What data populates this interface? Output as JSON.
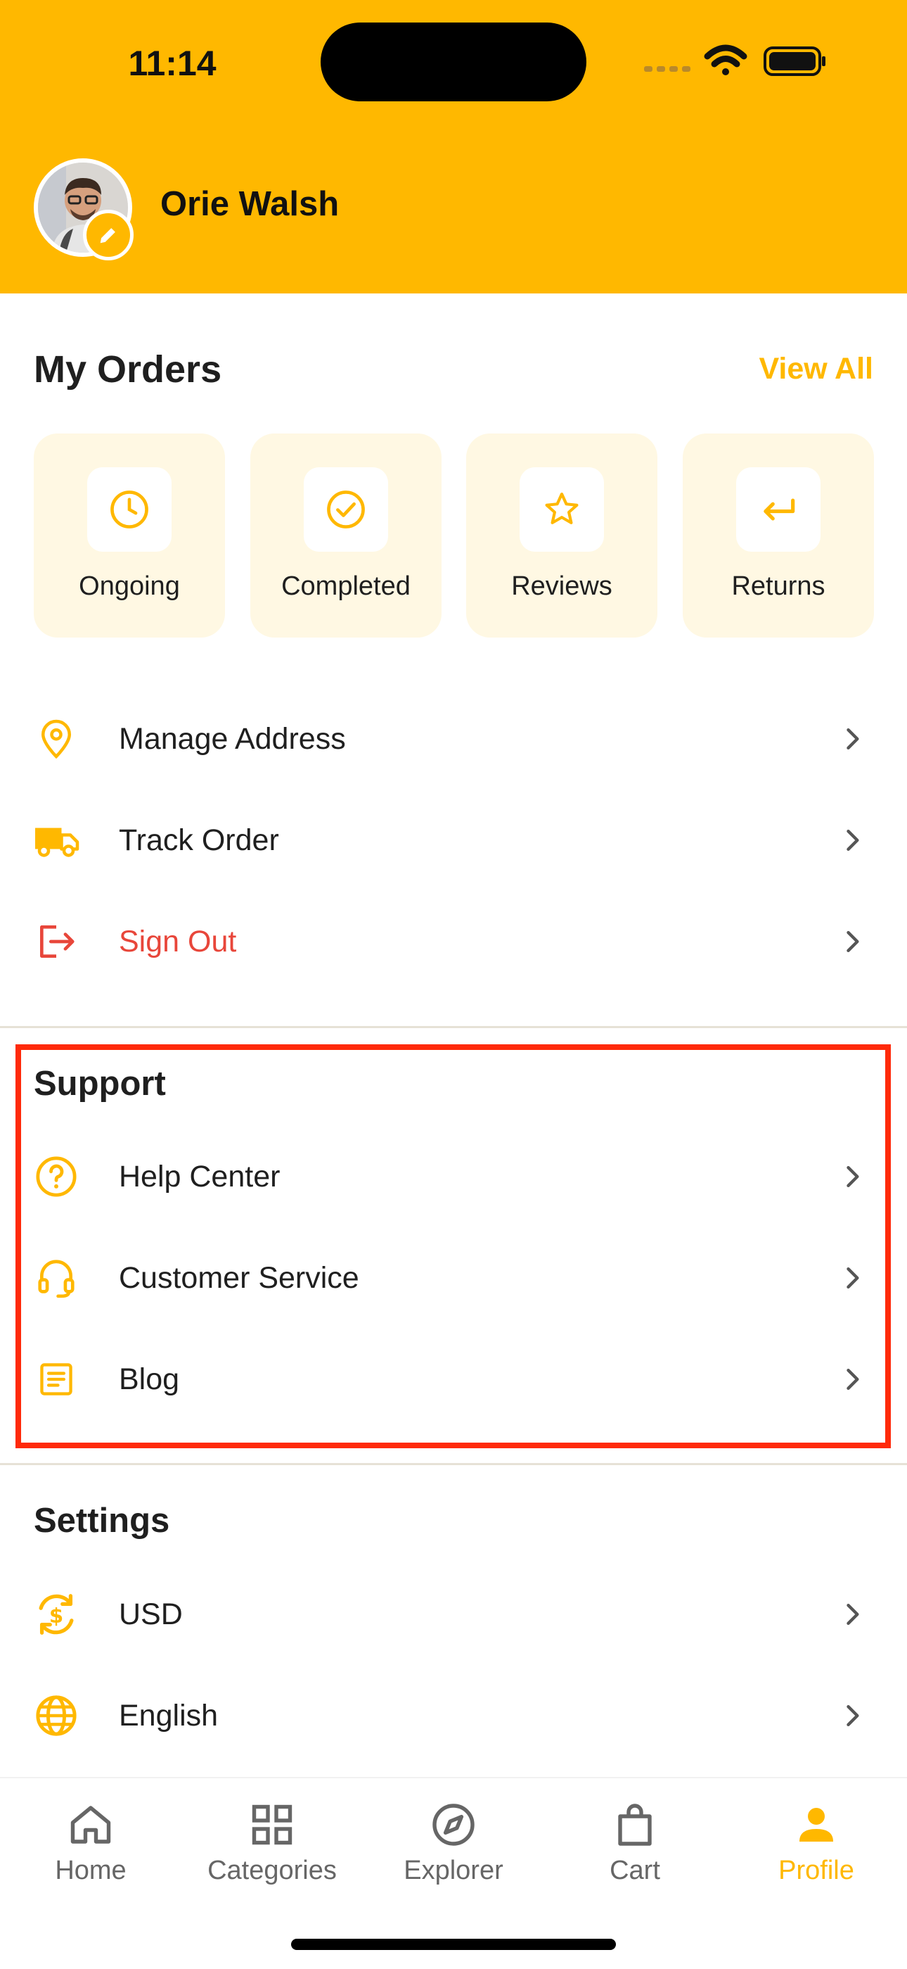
{
  "status_bar": {
    "time": "11:14"
  },
  "profile": {
    "name": "Orie Walsh"
  },
  "orders": {
    "title": "My Orders",
    "view_all": "View All",
    "items": [
      {
        "label": "Ongoing",
        "icon": "clock-icon"
      },
      {
        "label": "Completed",
        "icon": "check-circle-icon"
      },
      {
        "label": "Reviews",
        "icon": "star-icon"
      },
      {
        "label": "Returns",
        "icon": "return-arrow-icon"
      }
    ]
  },
  "account_menu": [
    {
      "label": "Manage Address",
      "icon": "location-pin-icon"
    },
    {
      "label": "Track Order",
      "icon": "truck-icon"
    },
    {
      "label": "Sign Out",
      "icon": "sign-out-icon",
      "color": "#E8463A"
    }
  ],
  "support": {
    "title": "Support",
    "items": [
      {
        "label": "Help Center",
        "icon": "help-circle-icon"
      },
      {
        "label": "Customer Service",
        "icon": "headset-icon"
      },
      {
        "label": "Blog",
        "icon": "document-icon"
      }
    ]
  },
  "settings": {
    "title": "Settings",
    "items": [
      {
        "label": "USD",
        "icon": "currency-exchange-icon"
      },
      {
        "label": "English",
        "icon": "globe-icon"
      }
    ]
  },
  "tabbar": {
    "tabs": [
      {
        "label": "Home",
        "icon": "home-icon"
      },
      {
        "label": "Categories",
        "icon": "grid-icon"
      },
      {
        "label": "Explorer",
        "icon": "compass-icon"
      },
      {
        "label": "Cart",
        "icon": "shopping-bag-icon"
      },
      {
        "label": "Profile",
        "icon": "person-icon",
        "active": true
      }
    ]
  },
  "colors": {
    "accent": "#FFB800",
    "card_bg": "#FFF8E3",
    "danger": "#E8463A",
    "highlight": "#FF2A0A"
  }
}
